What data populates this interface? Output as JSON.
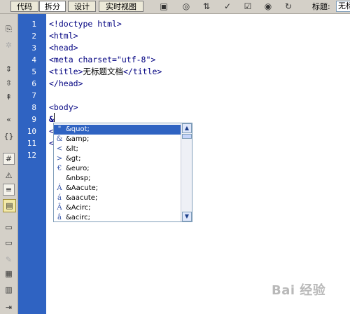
{
  "toolbar": {
    "views": [
      "代码",
      "拆分",
      "设计",
      "实时视图"
    ],
    "active_view": "拆分",
    "title_label": "标题:",
    "title_value": "无标题文档"
  },
  "line_numbers": [
    "1",
    "2",
    "3",
    "4",
    "5",
    "6",
    "7",
    "8",
    "9",
    "10",
    "11",
    "12"
  ],
  "code": {
    "l1": "<!doctype html>",
    "l2": "<html>",
    "l3": "<head>",
    "l4": "<meta charset=\"utf-8\">",
    "l5_open": "<title>",
    "l5_text": "无标题文档",
    "l5_close": "</title>",
    "l6": "</head>",
    "l7": "",
    "l8": "<body>",
    "l9": "&",
    "l10": "<",
    "l11": "<",
    "l12": ""
  },
  "autocomplete": {
    "items": [
      {
        "glyph": "\"",
        "entity": "&quot;"
      },
      {
        "glyph": "&",
        "entity": "&amp;"
      },
      {
        "glyph": "<",
        "entity": "&lt;"
      },
      {
        "glyph": ">",
        "entity": "&gt;"
      },
      {
        "glyph": "€",
        "entity": "&euro;"
      },
      {
        "glyph": "",
        "entity": "&nbsp;"
      },
      {
        "glyph": "Á",
        "entity": "&Aacute;"
      },
      {
        "glyph": "á",
        "entity": "&aacute;"
      },
      {
        "glyph": "Â",
        "entity": "&Acirc;"
      },
      {
        "glyph": "â",
        "entity": "&acirc;"
      }
    ]
  },
  "watermark": "Bai 经验"
}
